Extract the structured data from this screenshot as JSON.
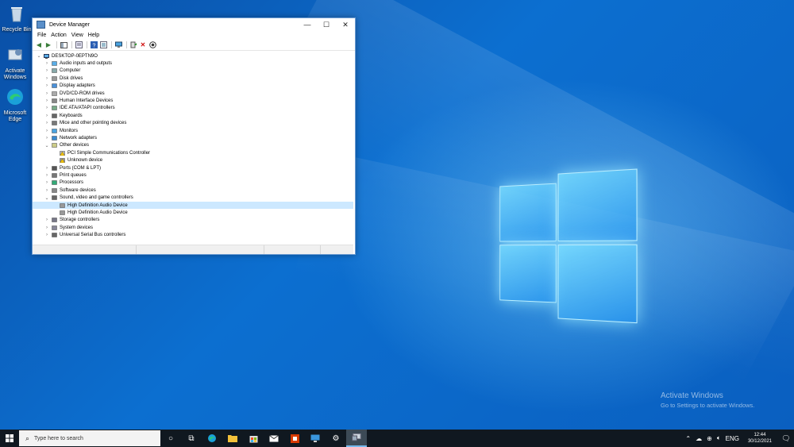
{
  "desktop": {
    "icons": [
      {
        "label": "Recycle Bin"
      },
      {
        "label": "Activate Windows"
      },
      {
        "label": "Microsoft Edge"
      }
    ],
    "watermark": {
      "title": "Activate Windows",
      "subtitle": "Go to Settings to activate Windows."
    }
  },
  "window": {
    "title": "Device Manager",
    "caption_buttons": [
      "minimize",
      "maximize",
      "close"
    ],
    "menu": [
      "File",
      "Action",
      "View",
      "Help"
    ],
    "toolbar": [
      {
        "icon": "back-arrow-icon"
      },
      {
        "icon": "forward-arrow-icon"
      },
      {
        "icon": "show-hide-console-tree-icon"
      },
      {
        "icon": "properties-icon"
      },
      {
        "icon": "help-icon"
      },
      {
        "icon": "view-icon"
      },
      {
        "icon": "scan-hardware-icon"
      },
      {
        "icon": "update-driver-icon"
      },
      {
        "icon": "uninstall-device-icon"
      },
      {
        "icon": "disable-device-icon"
      }
    ],
    "tree": {
      "root": "DESKTOP-0EPTN9O",
      "nodes": [
        {
          "label": "Audio inputs and outputs",
          "expanded": false,
          "level": 1
        },
        {
          "label": "Computer",
          "expanded": false,
          "level": 1
        },
        {
          "label": "Disk drives",
          "expanded": false,
          "level": 1
        },
        {
          "label": "Display adapters",
          "expanded": false,
          "level": 1
        },
        {
          "label": "DVD/CD-ROM drives",
          "expanded": false,
          "level": 1
        },
        {
          "label": "Human Interface Devices",
          "expanded": false,
          "level": 1
        },
        {
          "label": "IDE ATA/ATAPI controllers",
          "expanded": false,
          "level": 1
        },
        {
          "label": "Keyboards",
          "expanded": false,
          "level": 1
        },
        {
          "label": "Mice and other pointing devices",
          "expanded": false,
          "level": 1
        },
        {
          "label": "Monitors",
          "expanded": false,
          "level": 1
        },
        {
          "label": "Network adapters",
          "expanded": false,
          "level": 1
        },
        {
          "label": "Other devices",
          "expanded": true,
          "level": 1
        },
        {
          "label": "PCI Simple Communications Controller",
          "level": 2,
          "warning": true
        },
        {
          "label": "Unknown device",
          "level": 2,
          "warning": true
        },
        {
          "label": "Ports (COM & LPT)",
          "expanded": false,
          "level": 1
        },
        {
          "label": "Print queues",
          "expanded": false,
          "level": 1
        },
        {
          "label": "Processors",
          "expanded": false,
          "level": 1
        },
        {
          "label": "Software devices",
          "expanded": false,
          "level": 1
        },
        {
          "label": "Sound, video and game controllers",
          "expanded": true,
          "level": 1
        },
        {
          "label": "High Definition Audio Device",
          "level": 2,
          "selected": true
        },
        {
          "label": "High Definition Audio Device",
          "level": 2
        },
        {
          "label": "Storage controllers",
          "expanded": false,
          "level": 1
        },
        {
          "label": "System devices",
          "expanded": false,
          "level": 1
        },
        {
          "label": "Universal Serial Bus controllers",
          "expanded": false,
          "level": 1
        }
      ]
    }
  },
  "taskbar": {
    "search_placeholder": "Type here to search",
    "pinned": [
      "cortana",
      "task-view",
      "edge",
      "file-explorer",
      "store",
      "mail",
      "office",
      "remote-desktop",
      "settings",
      "device-manager"
    ],
    "tray": {
      "language": "ENG",
      "time": "12:44",
      "date": "30/12/2021"
    }
  },
  "colors": {
    "desktop_blue": "#0c6fd0",
    "selection": "#cce8ff",
    "taskbar": "#101820",
    "accent": "#76b9ed"
  }
}
